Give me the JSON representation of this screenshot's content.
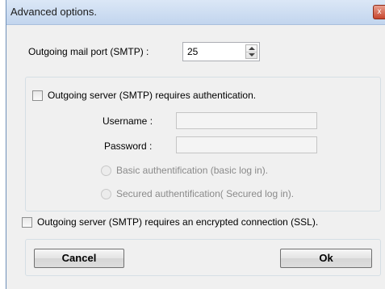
{
  "window": {
    "title": "Advanced options.",
    "close_glyph": "x"
  },
  "port": {
    "label": "Outgoing mail port (SMTP) :",
    "value": "25"
  },
  "auth": {
    "checkbox_label": "Outgoing server (SMTP) requires authentication.",
    "checked": false,
    "username_label": "Username :",
    "username_value": "",
    "password_label": "Password :",
    "password_value": "",
    "options": [
      "Basic authentification (basic log in).",
      "Secured authentification( Secured log in)."
    ]
  },
  "ssl": {
    "checkbox_label": "Outgoing server (SMTP) requires an encrypted connection (SSL).",
    "checked": false
  },
  "buttons": {
    "cancel": "Cancel",
    "ok": "Ok"
  },
  "icons": {
    "close": "close-icon",
    "spin_up": "spin-up-arrow-icon",
    "spin_down": "spin-down-arrow-icon"
  },
  "colors": {
    "titlebar": "#c2d5ee",
    "dialog_bg": "#f0f0f0",
    "close_button": "#c6452d",
    "disabled_text": "#8a8a8a"
  }
}
